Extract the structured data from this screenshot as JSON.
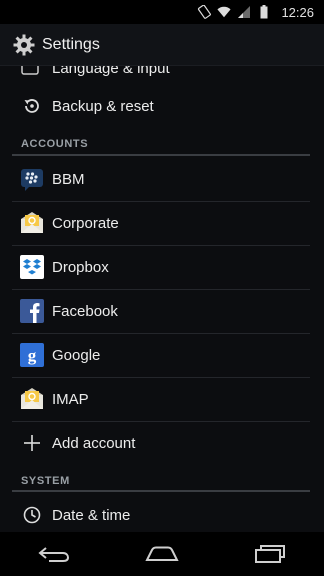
{
  "status_bar": {
    "time": "12:26",
    "icons": [
      "rotation-icon",
      "wifi-icon",
      "signal-icon",
      "battery-icon"
    ]
  },
  "action_bar": {
    "title": "Settings",
    "icon": "gear-icon"
  },
  "list": {
    "partial_item": {
      "label": "Language & input",
      "icon": "language-icon"
    },
    "backup_item": {
      "label": "Backup & reset",
      "icon": "backup-reset-icon"
    },
    "accounts_section": "ACCOUNTS",
    "accounts": [
      {
        "label": "BBM",
        "icon": "bbm-icon"
      },
      {
        "label": "Corporate",
        "icon": "email-envelope-icon"
      },
      {
        "label": "Dropbox",
        "icon": "dropbox-icon"
      },
      {
        "label": "Facebook",
        "icon": "facebook-icon"
      },
      {
        "label": "Google",
        "icon": "google-icon"
      },
      {
        "label": "IMAP",
        "icon": "email-envelope-icon"
      },
      {
        "label": "Add account",
        "icon": "plus-icon"
      }
    ],
    "system_section": "SYSTEM",
    "system": [
      {
        "label": "Date & time",
        "icon": "clock-icon"
      }
    ]
  },
  "nav_bar": {
    "buttons": [
      "back-icon",
      "home-icon",
      "recents-icon"
    ]
  },
  "colors": {
    "background": "#0c0d10",
    "action_bar": "#111317",
    "section_text": "#9aa0a6",
    "facebook_blue": "#3b5998",
    "dropbox_blue": "#1f7fd1",
    "google_blue": "#2f6fd6",
    "envelope_yellow": "#f3c240"
  }
}
